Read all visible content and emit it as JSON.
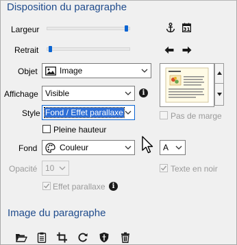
{
  "section_title": "Disposition du paragraphe",
  "image_section_title": "Image du paragraphe",
  "labels": {
    "largeur": "Largeur",
    "retrait": "Retrait",
    "objet": "Objet",
    "affichage": "Affichage",
    "style": "Style",
    "fond": "Fond",
    "opacite": "Opacité"
  },
  "sliders": {
    "largeur_level": 0.98,
    "retrait_level": 0.02
  },
  "objet": {
    "value": "Image",
    "icon": "image-icon"
  },
  "affichage": {
    "value": "Visible"
  },
  "style": {
    "value": "Fond / Effet parallaxe"
  },
  "pleine_hauteur": {
    "label": "Pleine hauteur",
    "checked": false
  },
  "fond": {
    "value": "Couleur",
    "icon": "palette-icon"
  },
  "font_select": {
    "value": "A"
  },
  "opacite": {
    "value": "10"
  },
  "effet_parallaxe": {
    "label": "Effet parallaxe",
    "checked": true
  },
  "pas_de_marge": {
    "label": "Pas de marge",
    "checked": false
  },
  "texte_en_noir": {
    "label": "Texte en noir",
    "checked": true
  },
  "colors": {
    "title": "#1f4b8c",
    "accent": "#0a64d2",
    "selection": "#2e6fd6"
  }
}
